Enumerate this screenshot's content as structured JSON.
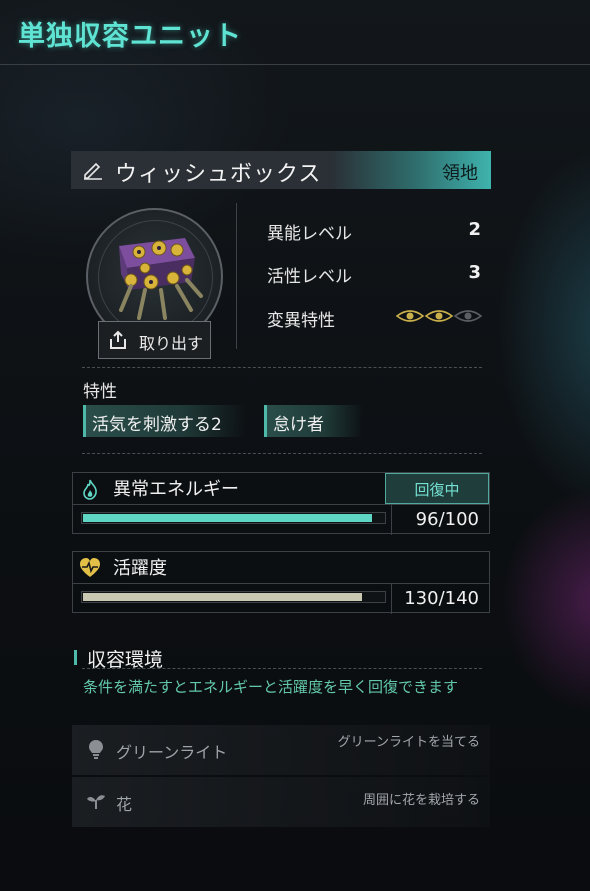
{
  "header": {
    "title": "単独収容ユニット"
  },
  "anomaly": {
    "name": "ウィッシュボックス",
    "category": "領地",
    "take_out_label": "取り出す",
    "stats": [
      {
        "label": "異能レベル",
        "value": "2"
      },
      {
        "label": "活性レベル",
        "value": "3"
      },
      {
        "label": "変異特性",
        "value": ""
      }
    ],
    "mutation": {
      "filled": 2,
      "total": 3
    }
  },
  "traits": {
    "title": "特性",
    "items": [
      "活気を刺激する2",
      "怠け者"
    ]
  },
  "energy": {
    "title": "異常エネルギー",
    "status": "回復中",
    "current": 96,
    "max": 100,
    "value_text": "96/100",
    "fill_color": "#5fd6c4"
  },
  "activity": {
    "title": "活躍度",
    "current": 130,
    "max": 140,
    "value_text": "130/140",
    "fill_color": "#c8c9b0"
  },
  "environment": {
    "title": "収容環境",
    "description": "条件を満たすとエネルギーと活躍度を早く回復できます",
    "conditions": [
      {
        "label": "グリーンライト",
        "requirement": "グリーンライトを当てる",
        "icon": "lightbulb-icon"
      },
      {
        "label": "花",
        "requirement": "周囲に花を栽培する",
        "icon": "sprout-icon"
      }
    ]
  },
  "colors": {
    "accent": "#5fe3d2",
    "teal_panel": "#3fb3ad"
  }
}
